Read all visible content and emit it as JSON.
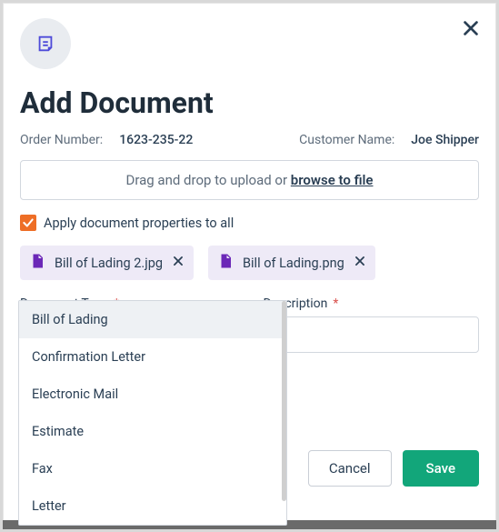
{
  "header": {
    "title": "Add Document"
  },
  "meta": {
    "order_label": "Order Number:",
    "order_value": "1623-235-22",
    "customer_label": "Customer Name:",
    "customer_value": "Joe Shipper"
  },
  "dropzone": {
    "text_prefix": "Drag and drop to upload or ",
    "browse_label": "browse to file"
  },
  "apply_all": {
    "checked": true,
    "label": "Apply document properties to all"
  },
  "files": [
    {
      "name": "Bill of Lading 2.jpg"
    },
    {
      "name": "Bill of Lading.png"
    }
  ],
  "fields": {
    "doc_type": {
      "label": "Document Type",
      "required": "*",
      "options": [
        "Bill of Lading",
        "Confirmation Letter",
        "Electronic Mail",
        "Estimate",
        "Fax",
        "Letter"
      ],
      "selected_index": 0
    },
    "description": {
      "label": "Description",
      "required": "*",
      "value": ""
    }
  },
  "actions": {
    "cancel": "Cancel",
    "save": "Save"
  },
  "icons": {
    "close": "close-icon",
    "note": "note-icon",
    "file": "file-image-icon",
    "chip_remove": "close-icon",
    "check": "check-icon"
  }
}
